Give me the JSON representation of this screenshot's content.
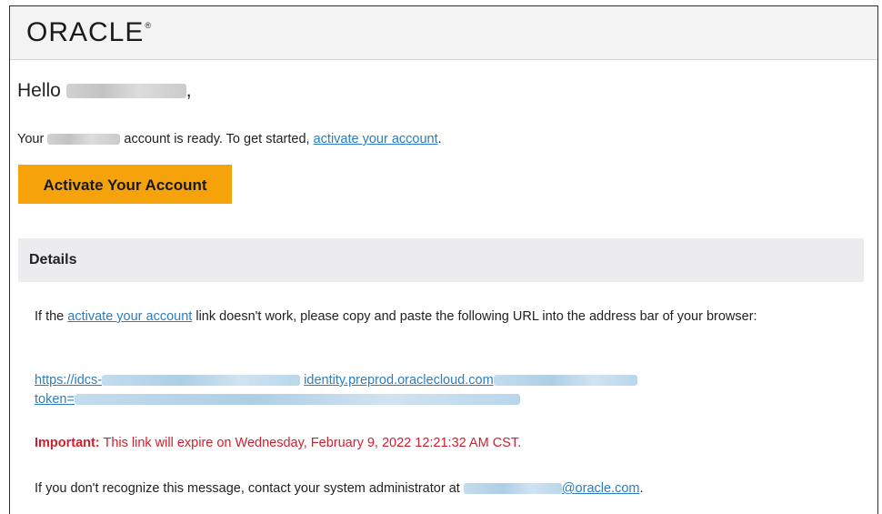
{
  "header": {
    "logo_text": "ORACLE",
    "logo_mark": "®"
  },
  "greeting": {
    "prefix": "Hello",
    "suffix": ","
  },
  "intro": {
    "before_redacted": "Your",
    "after_redacted": "account is ready. To get started,",
    "link_text": "activate your account",
    "end": "."
  },
  "activate_button": {
    "label": "Activate Your Account"
  },
  "details": {
    "title": "Details",
    "paragraph_start": "If the",
    "paragraph_link": "activate your account",
    "paragraph_end": "link doesn't work, please copy and paste the following URL into the address bar of your browser:",
    "url_line1_start": "https://idcs-",
    "url_line1_mid": "identity.preprod.oraclecloud.com",
    "url_line2_start": "token=",
    "important_label": "Important:",
    "important_text": "This link will expire on Wednesday, February 9, 2022 12:21:32 AM CST.",
    "contact_text": "If you don't recognize this message, contact your system administrator at",
    "contact_domain": "@oracle.com",
    "contact_end": "."
  },
  "colors": {
    "accent_button": "#f5a20b",
    "link": "#2a7ec0",
    "warning": "#d0202f",
    "details_bg": "#ececee"
  }
}
